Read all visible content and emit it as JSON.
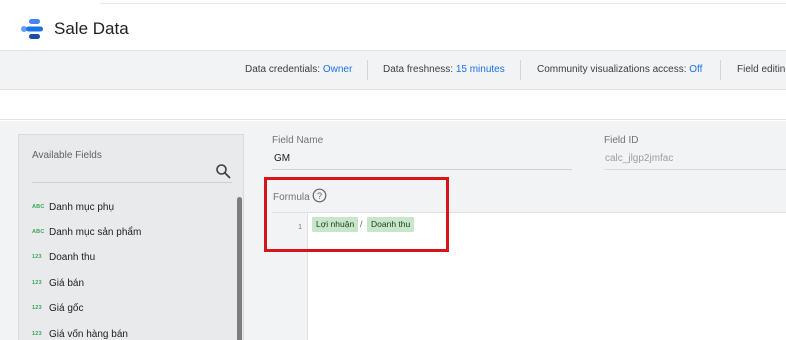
{
  "header": {
    "title": "Sale Data",
    "logo_icon": "looker-studio-icon"
  },
  "settings": {
    "credentials_label": "Data credentials:",
    "credentials_value": "Owner",
    "freshness_label": "Data freshness:",
    "freshness_value": "15 minutes",
    "community_label": "Community visualizations access:",
    "community_value": "Off",
    "field_editing_label": "Field editin"
  },
  "fields_panel": {
    "title": "Available Fields",
    "search_icon": "search-icon",
    "items": [
      {
        "type": "ABC",
        "label": "Danh mục phụ"
      },
      {
        "type": "ABC",
        "label": "Danh mục sản phẩm"
      },
      {
        "type": "123",
        "label": "Doanh thu"
      },
      {
        "type": "123",
        "label": "Giá bán"
      },
      {
        "type": "123",
        "label": "Giá gốc"
      },
      {
        "type": "123",
        "label": "Giá vốn hàng bán"
      }
    ]
  },
  "editor": {
    "field_name_label": "Field Name",
    "field_name_value": "GM",
    "field_id_label": "Field ID",
    "field_id_value": "calc_jlgp2jmfac",
    "formula_label": "Formula",
    "help_icon": "help-circle-icon",
    "line_number": "1",
    "formula_left": "Lợi nhuận",
    "formula_operator": "/",
    "formula_right": "Doanh thu"
  },
  "colors": {
    "accent_blue": "#1a73e8",
    "chip_green": "#c8e6c9",
    "type_green": "#3aa757",
    "highlight_red": "#d7141a"
  }
}
